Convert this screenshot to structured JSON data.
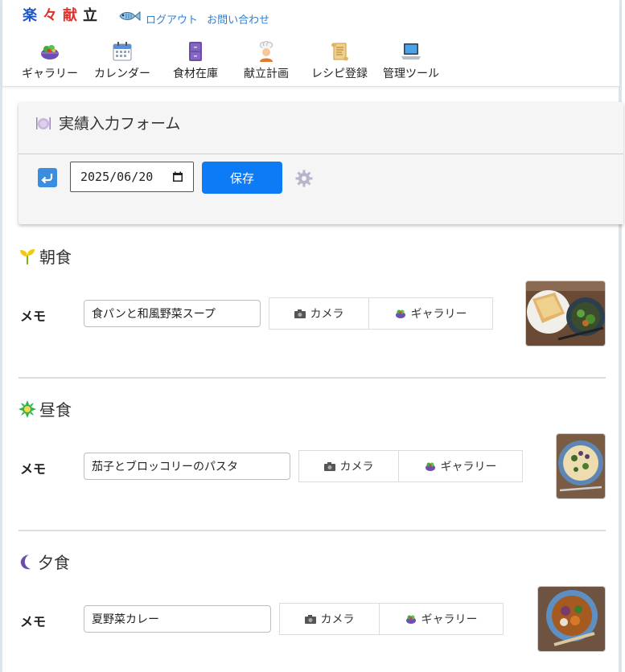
{
  "app": {
    "logo_chars": [
      "楽",
      "々",
      "献",
      "立"
    ],
    "logo_colors": [
      "#1a56c9",
      "#e0322a",
      "#e0322a",
      "#222222"
    ],
    "links": {
      "logout": "ログアウト",
      "contact": "お問い合わせ"
    }
  },
  "nav": {
    "items": [
      {
        "label": "ギャラリー",
        "icon": "salad-bowl-icon"
      },
      {
        "label": "カレンダー",
        "icon": "calendar-icon"
      },
      {
        "label": "食材在庫",
        "icon": "cabinet-icon"
      },
      {
        "label": "献立計画",
        "icon": "chef-icon"
      },
      {
        "label": "レシピ登録",
        "icon": "scroll-icon"
      },
      {
        "label": "管理ツール",
        "icon": "laptop-icon"
      }
    ]
  },
  "form": {
    "title": "実績入力フォーム",
    "date_value": "2025/06/20",
    "save_label": "保存"
  },
  "meals": [
    {
      "title": "朝食",
      "memo_label": "メモ",
      "memo_value": "食パンと和風野菜スープ",
      "camera_label": "カメラ",
      "gallery_label": "ギャラリー"
    },
    {
      "title": "昼食",
      "memo_label": "メモ",
      "memo_value": "茄子とブロッコリーのパスタ",
      "camera_label": "カメラ",
      "gallery_label": "ギャラリー"
    },
    {
      "title": "夕食",
      "memo_label": "メモ",
      "memo_value": "夏野菜カレー",
      "camera_label": "カメラ",
      "gallery_label": "ギャラリー"
    }
  ],
  "colors": {
    "accent": "#0d7bf6",
    "link": "#2f7fd6"
  }
}
